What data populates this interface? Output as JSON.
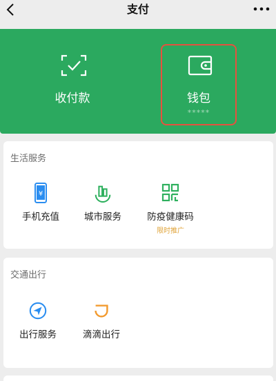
{
  "nav": {
    "title": "支付"
  },
  "pay": {
    "collect_label": "收付款",
    "wallet_label": "钱包",
    "wallet_balance": "*****"
  },
  "life": {
    "title": "生活服务",
    "items": [
      {
        "label": "手机充值",
        "icon": "phone-recharge-icon"
      },
      {
        "label": "城市服务",
        "icon": "city-service-icon"
      },
      {
        "label": "防疫健康码",
        "icon": "qr-code-icon",
        "tag": "限时推广"
      }
    ]
  },
  "traffic": {
    "title": "交通出行",
    "items": [
      {
        "label": "出行服务",
        "icon": "navigation-icon"
      },
      {
        "label": "滴滴出行",
        "icon": "didi-icon"
      }
    ]
  },
  "colors": {
    "brand_green": "#2ba95f",
    "highlight": "#e8503e",
    "tag": "#e0a43a",
    "icon_blue": "#2a8df0",
    "icon_green": "#2eb05e",
    "icon_orange": "#f29a2e"
  }
}
